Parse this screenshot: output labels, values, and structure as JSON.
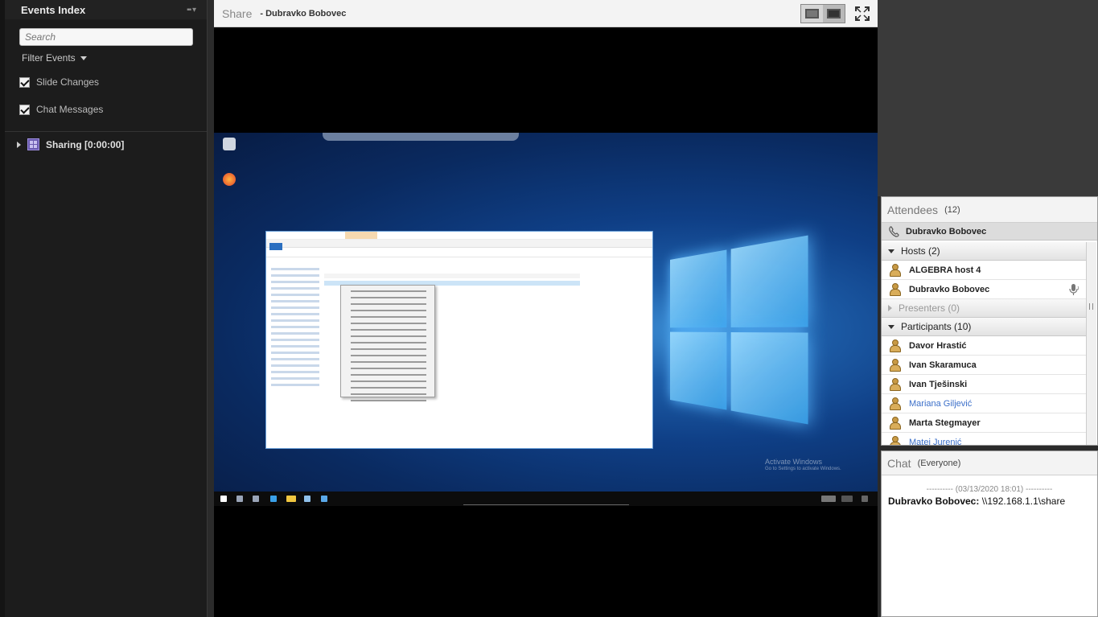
{
  "events": {
    "title": "Events Index",
    "search_placeholder": "Search",
    "filter_label": "Filter Events",
    "filters": [
      {
        "label": "Slide Changes",
        "checked": true
      },
      {
        "label": "Chat Messages",
        "checked": true
      }
    ],
    "entries": [
      {
        "label": "Sharing [0:00:00]"
      }
    ]
  },
  "share": {
    "title": "Share",
    "presenter": "- Dubravko Bobovec",
    "watermark_line1": "Activate Windows",
    "watermark_line2": "Go to Settings to activate Windows."
  },
  "attendees": {
    "title": "Attendees",
    "count": "(12)",
    "current_user": "Dubravko Bobovec",
    "groups": [
      {
        "label": "Hosts (2)",
        "expanded": true,
        "members": [
          {
            "name": "ALGEBRA host 4",
            "highlight": false,
            "mic": false
          },
          {
            "name": "Dubravko Bobovec",
            "highlight": false,
            "mic": true
          }
        ]
      },
      {
        "label": "Presenters (0)",
        "expanded": false,
        "members": []
      },
      {
        "label": "Participants (10)",
        "expanded": true,
        "members": [
          {
            "name": "Davor Hrastić",
            "highlight": false
          },
          {
            "name": "Ivan Skaramuca",
            "highlight": false
          },
          {
            "name": "Ivan Tješinski",
            "highlight": false
          },
          {
            "name": "Mariana Giljević",
            "highlight": true
          },
          {
            "name": "Marta Stegmayer",
            "highlight": false
          },
          {
            "name": "Matej Jurenić",
            "highlight": true
          }
        ]
      }
    ]
  },
  "chat": {
    "title": "Chat",
    "audience": "(Everyone)",
    "date_line": "---------- (03/13/2020 18:01) ----------",
    "messages": [
      {
        "sender": "Dubravko Bobovec:",
        "text": "\\\\192.168.1.1\\share"
      }
    ]
  },
  "colors": {
    "highlight_name": "#3b6fc9",
    "events_bg": "#1c1c1c",
    "share_bg": "#000000"
  }
}
